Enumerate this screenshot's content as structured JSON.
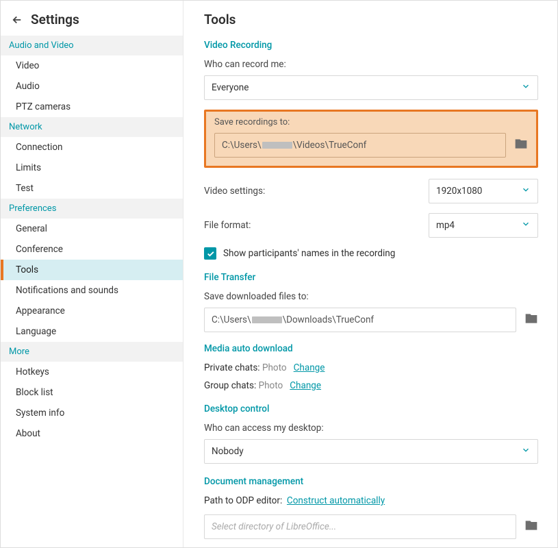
{
  "header": {
    "title": "Settings"
  },
  "sidebar": {
    "groups": [
      {
        "label": "Audio and Video",
        "items": [
          "Video",
          "Audio",
          "PTZ cameras"
        ]
      },
      {
        "label": "Network",
        "items": [
          "Connection",
          "Limits",
          "Test"
        ]
      },
      {
        "label": "Preferences",
        "items": [
          "General",
          "Conference",
          "Tools",
          "Notifications and sounds",
          "Appearance",
          "Language"
        ]
      },
      {
        "label": "More",
        "items": [
          "Hotkeys",
          "Block list",
          "System info",
          "About"
        ]
      }
    ],
    "active": "Tools"
  },
  "main": {
    "title": "Tools",
    "videoRecording": {
      "title": "Video Recording",
      "whoLabel": "Who can record me:",
      "whoValue": "Everyone",
      "saveLabel": "Save recordings to:",
      "savePathPrefix": "C:\\Users\\",
      "savePathSuffix": "\\Videos\\TrueConf",
      "videoSettingsLabel": "Video settings:",
      "videoSettingsValue": "1920x1080",
      "fileFormatLabel": "File format:",
      "fileFormatValue": "mp4",
      "showNamesLabel": "Show participants' names in the recording",
      "showNamesChecked": true
    },
    "fileTransfer": {
      "title": "File Transfer",
      "saveLabel": "Save downloaded files to:",
      "pathPrefix": "C:\\Users\\",
      "pathSuffix": "\\Downloads\\TrueConf"
    },
    "mediaAuto": {
      "title": "Media auto download",
      "privateLabel": "Private chats:",
      "privateValue": "Photo",
      "groupLabel": "Group chats:",
      "groupValue": "Photo",
      "changeLabel": "Change"
    },
    "desktopControl": {
      "title": "Desktop control",
      "whoLabel": "Who can access my desktop:",
      "whoValue": "Nobody"
    },
    "docMgmt": {
      "title": "Document management",
      "pathLabel": "Path to ODP editor:",
      "constructLink": "Construct automatically",
      "placeholder": "Select directory of LibreOffice..."
    }
  }
}
